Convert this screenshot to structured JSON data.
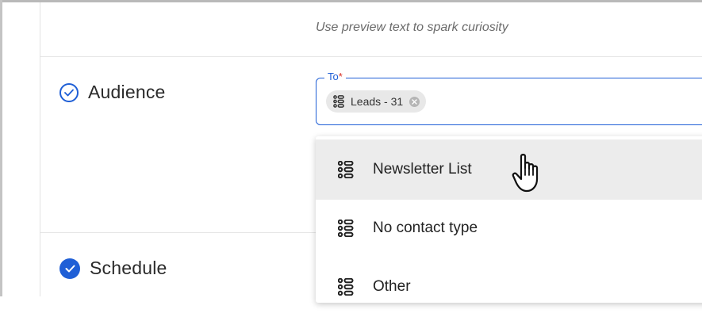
{
  "preview_hint": "Use preview text to spark curiosity",
  "audience": {
    "label": "Audience",
    "to_field": {
      "label": "To",
      "required_mark": "*",
      "chip": {
        "label": "Leads - 31"
      }
    }
  },
  "schedule": {
    "label": "Schedule"
  },
  "dropdown": {
    "options": [
      {
        "label": "Newsletter List",
        "hovered": true
      },
      {
        "label": "No contact type",
        "hovered": false
      },
      {
        "label": "Other",
        "hovered": false
      }
    ]
  },
  "colors": {
    "accent": "#1f5fd6",
    "required": "#d93025",
    "hover": "#ececec"
  }
}
